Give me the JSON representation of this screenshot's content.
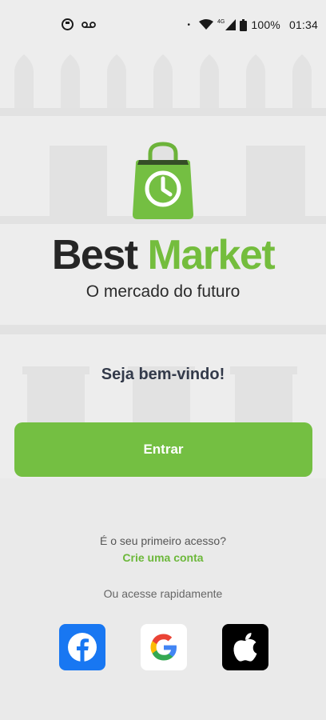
{
  "status_bar": {
    "battery": "100%",
    "time": "01:34",
    "network": "4G"
  },
  "brand": {
    "part1": "Best",
    "part2": "Market",
    "tagline": "O mercado do futuro"
  },
  "welcome": "Seja bem-vindo!",
  "enter_button": "Entrar",
  "signup": {
    "question": "É o seu primeiro acesso?",
    "link": "Crie uma conta"
  },
  "quick_access": "Ou acesse rapidamente",
  "social_buttons": [
    {
      "name": "facebook",
      "icon": "facebook-icon"
    },
    {
      "name": "google",
      "icon": "google-icon"
    },
    {
      "name": "apple",
      "icon": "apple-icon"
    }
  ],
  "colors": {
    "accent_green": "#74bf42",
    "text_dark": "#262626",
    "background": "#efefef",
    "facebook_blue": "#1877f2"
  }
}
